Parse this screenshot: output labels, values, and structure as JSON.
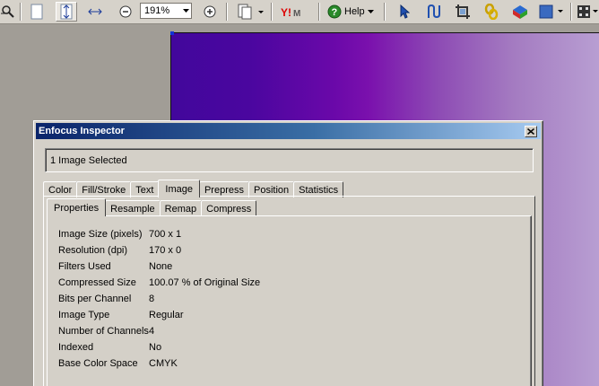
{
  "toolbar": {
    "zoom_value": "191%",
    "help_label": "Help"
  },
  "inspector": {
    "title": "Enfocus Inspector",
    "selection_text": "1 Image Selected",
    "tabs": [
      "Color",
      "Fill/Stroke",
      "Text",
      "Image",
      "Prepress",
      "Position",
      "Statistics"
    ],
    "active_tab": "Image",
    "subtabs": [
      "Properties",
      "Resample",
      "Remap",
      "Compress"
    ],
    "active_subtab": "Properties",
    "properties": [
      {
        "label": "Image Size (pixels)",
        "value": "700 x 1"
      },
      {
        "label": "Resolution (dpi)",
        "value": "170 x 0"
      },
      {
        "label": "Filters Used",
        "value": "None"
      },
      {
        "label": "Compressed Size",
        "value": "100.07 % of Original Size"
      },
      {
        "label": "Bits per Channel",
        "value": "8"
      },
      {
        "label": "Image Type",
        "value": "Regular"
      },
      {
        "label": "Number of Channels",
        "value": "4"
      },
      {
        "label": "Indexed",
        "value": "No"
      },
      {
        "label": "Base Color Space",
        "value": "CMYK"
      }
    ]
  },
  "colors": {
    "titlebar_start": "#0a246a",
    "titlebar_end": "#a6caf0",
    "gradient_start": "#42079c",
    "gradient_end": "#b89ed2"
  }
}
